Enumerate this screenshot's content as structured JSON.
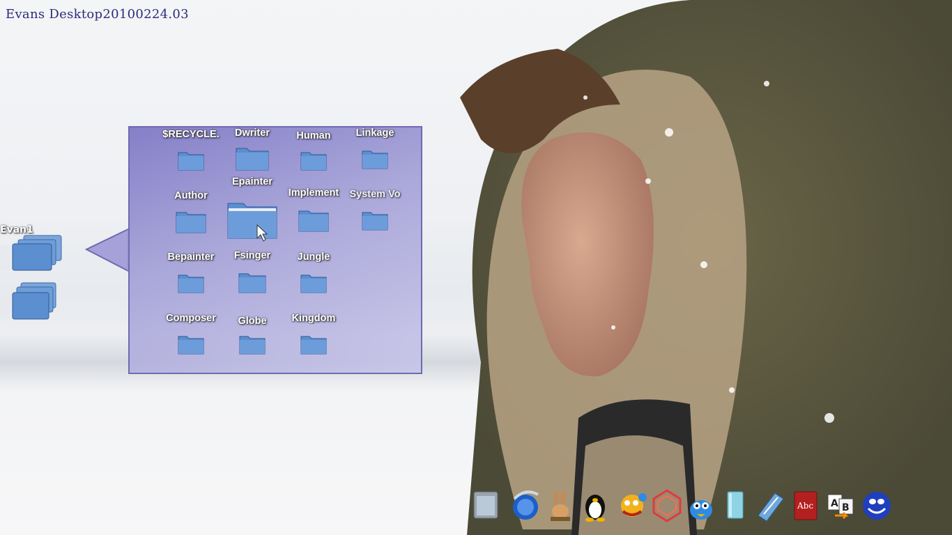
{
  "desktop": {
    "title": "Evans Desktop20100224.03"
  },
  "stacks": [
    {
      "label": "Evan1"
    },
    {
      "label": ""
    }
  ],
  "folder_popup": {
    "folders": [
      {
        "label": "$RECYCLE."
      },
      {
        "label": "Dwriter"
      },
      {
        "label": "Human"
      },
      {
        "label": "Linkage"
      },
      {
        "label": "Author"
      },
      {
        "label": "Epainter"
      },
      {
        "label": "Implement"
      },
      {
        "label": "System Vo"
      },
      {
        "label": "Bepainter"
      },
      {
        "label": "Fsinger"
      },
      {
        "label": "Jungle"
      },
      {
        "label": "Composer"
      },
      {
        "label": "Globe"
      },
      {
        "label": "Kingdom"
      }
    ]
  },
  "dock": {
    "items": [
      {
        "icon": "cabinet-icon"
      },
      {
        "icon": "blue-orb-icon"
      },
      {
        "icon": "rabbit-icon"
      },
      {
        "icon": "penguin-icon"
      },
      {
        "icon": "dj-character-icon"
      },
      {
        "icon": "red-polygon-icon"
      },
      {
        "icon": "blue-bird-icon"
      },
      {
        "icon": "notepad-icon"
      },
      {
        "icon": "pen-tablet-icon"
      },
      {
        "icon": "abc-book-icon"
      },
      {
        "icon": "ab-translate-icon"
      },
      {
        "icon": "blue-smiley-icon"
      }
    ]
  },
  "colors": {
    "panel_border": "#6e6ab2",
    "title": "#2b2b7a",
    "folder": "#5b8fd0"
  }
}
